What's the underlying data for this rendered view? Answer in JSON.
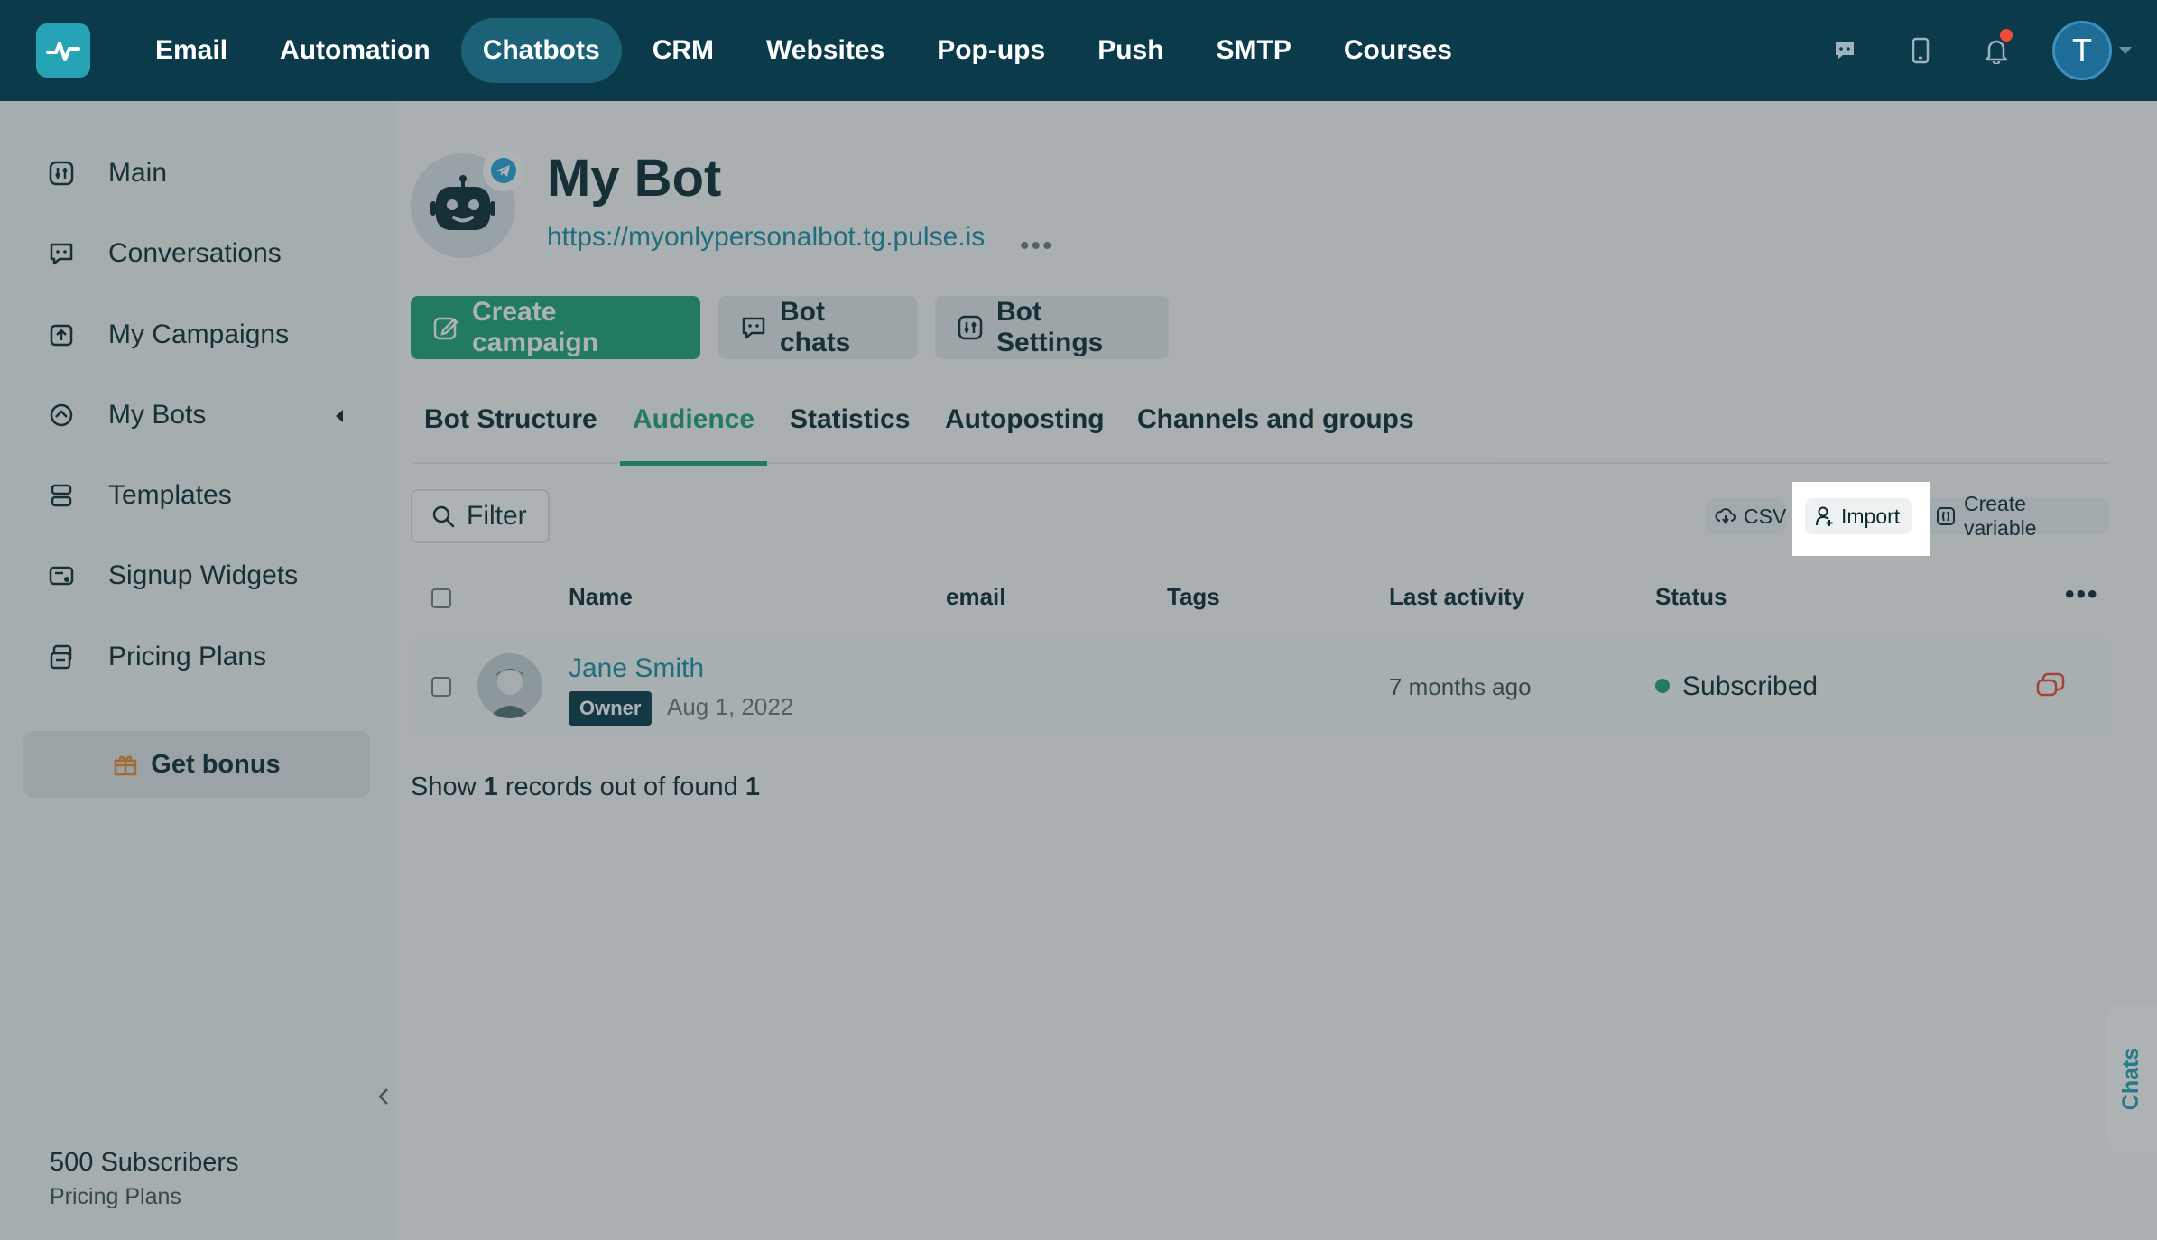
{
  "topnav": {
    "items": [
      {
        "label": "Email"
      },
      {
        "label": "Automation"
      },
      {
        "label": "Chatbots",
        "active": true
      },
      {
        "label": "CRM"
      },
      {
        "label": "Websites"
      },
      {
        "label": "Pop-ups"
      },
      {
        "label": "Push"
      },
      {
        "label": "SMTP"
      },
      {
        "label": "Courses"
      }
    ],
    "user_initial": "T",
    "icons": [
      "chat-icon",
      "mobile-icon",
      "bell-icon"
    ]
  },
  "sidebar": {
    "items": [
      {
        "label": "Main",
        "icon": "dashboard-icon"
      },
      {
        "label": "Conversations",
        "icon": "chat-bubble-icon"
      },
      {
        "label": "My Campaigns",
        "icon": "campaign-icon"
      },
      {
        "label": "My Bots",
        "icon": "bot-icon"
      },
      {
        "label": "Templates",
        "icon": "templates-icon"
      },
      {
        "label": "Signup Widgets",
        "icon": "widget-icon"
      },
      {
        "label": "Pricing Plans",
        "icon": "pricing-icon"
      }
    ],
    "bonus_label": "Get bonus",
    "subscribers": "500 Subscribers",
    "plan_link": "Pricing Plans"
  },
  "bot": {
    "name": "My Bot",
    "url": "https://myonlypersonalbot.tg.pulse.is"
  },
  "actions": {
    "create_campaign": "Create campaign",
    "bot_chats": "Bot chats",
    "bot_settings": "Bot Settings"
  },
  "tabs": [
    {
      "label": "Bot Structure"
    },
    {
      "label": "Audience",
      "active": true
    },
    {
      "label": "Statistics"
    },
    {
      "label": "Autoposting"
    },
    {
      "label": "Channels and groups"
    }
  ],
  "toolbar": {
    "filter": "Filter",
    "csv": "CSV",
    "import": "Import",
    "create_variable": "Create variable"
  },
  "table": {
    "columns": [
      "Name",
      "email",
      "Tags",
      "Last activity",
      "Status"
    ],
    "rows": [
      {
        "name": "Jane Smith",
        "badge": "Owner",
        "date": "Aug 1, 2022",
        "email": "",
        "tags": "",
        "last_activity": "7 months ago",
        "status": "Subscribed"
      }
    ]
  },
  "records": {
    "prefix": "Show",
    "shown": "1",
    "middle": "records out of found",
    "found": "1"
  },
  "chats_tab": "Chats",
  "colors": {
    "topbar": "#0b3b4a",
    "accent": "#1fa37b",
    "link": "#1a8fa6",
    "active_nav": "#1b6277"
  }
}
